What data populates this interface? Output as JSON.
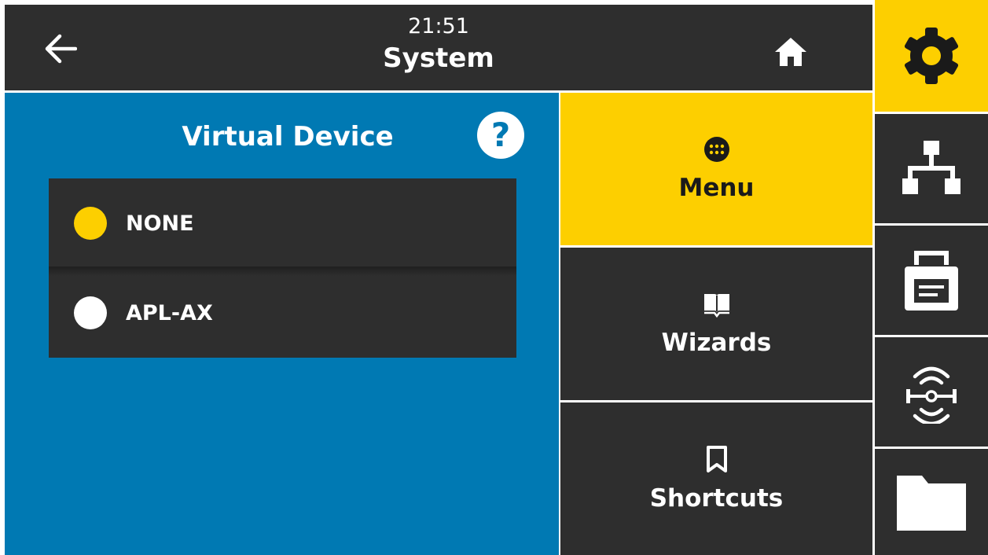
{
  "header": {
    "time": "21:51",
    "title": "System"
  },
  "panel": {
    "title": "Virtual Device",
    "options": [
      {
        "label": "NONE",
        "selected": true
      },
      {
        "label": "APL-AX",
        "selected": false
      }
    ]
  },
  "nav": {
    "items": [
      {
        "label": "Menu",
        "icon": "menu-dots-icon"
      },
      {
        "label": "Wizards",
        "icon": "book-icon"
      },
      {
        "label": "Shortcuts",
        "icon": "bookmark-icon"
      }
    ]
  },
  "rail": {
    "items": [
      "gear-icon",
      "network-icon",
      "printer-icon",
      "rfid-icon",
      "folder-icon"
    ]
  },
  "colors": {
    "accent": "#fdcf00",
    "panel": "#0079b3",
    "dark": "#2e2e2e",
    "text": "#ffffff"
  }
}
